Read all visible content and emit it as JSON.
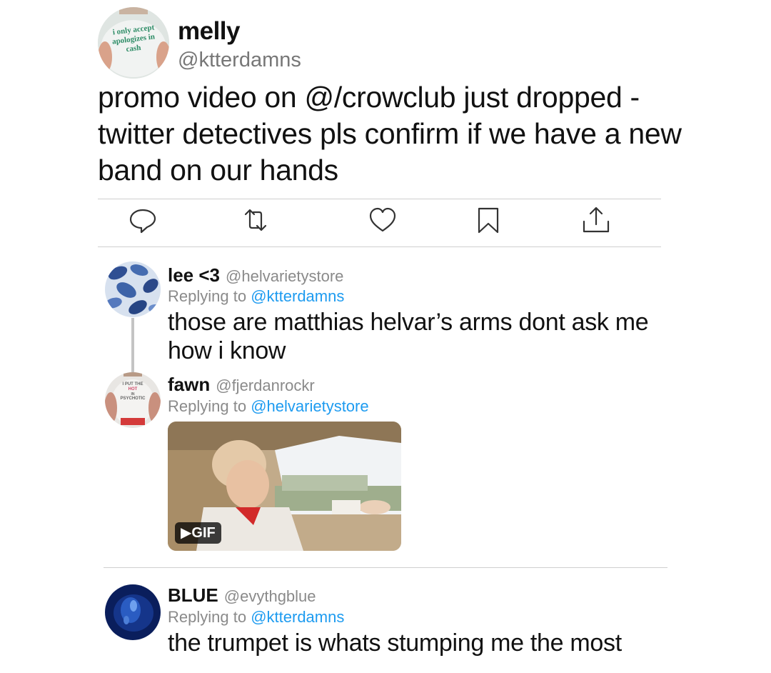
{
  "main_tweet": {
    "avatar_shirt_lines": [
      "i only accept",
      "apologizes in",
      "cash"
    ],
    "name": "melly",
    "handle": "@ktterdamns",
    "text": "promo video on @/crowclub just dropped - twitter detectives pls confirm if we have a new band on our hands",
    "actions": [
      "reply-icon",
      "retweet-icon",
      "like-icon",
      "bookmark-icon",
      "share-icon"
    ]
  },
  "replies": [
    {
      "name": "lee <3",
      "handle": "@helvarietystore",
      "replying_prefix": "Replying to",
      "replying_to": "@ktterdamns",
      "text": "those are matthias helvar’s arms dont ask me how i know"
    },
    {
      "name": "fawn",
      "handle": "@fjerdanrockr",
      "replying_prefix": "Replying to",
      "replying_to": "@helvarietystore",
      "avatar_shirt_lines": [
        "I PUT THE",
        "HOT",
        "IN",
        "PSYCHOTIC"
      ],
      "media_badge": "GIF"
    },
    {
      "name": "BLUE",
      "handle": "@evythgblue",
      "replying_prefix": "Replying to",
      "replying_to": "@ktterdamns",
      "text": "the trumpet is whats stumping me the most"
    }
  ],
  "colors": {
    "link": "#1d9bf0",
    "muted": "#8a8a8a",
    "divider": "#cfcfcf"
  }
}
